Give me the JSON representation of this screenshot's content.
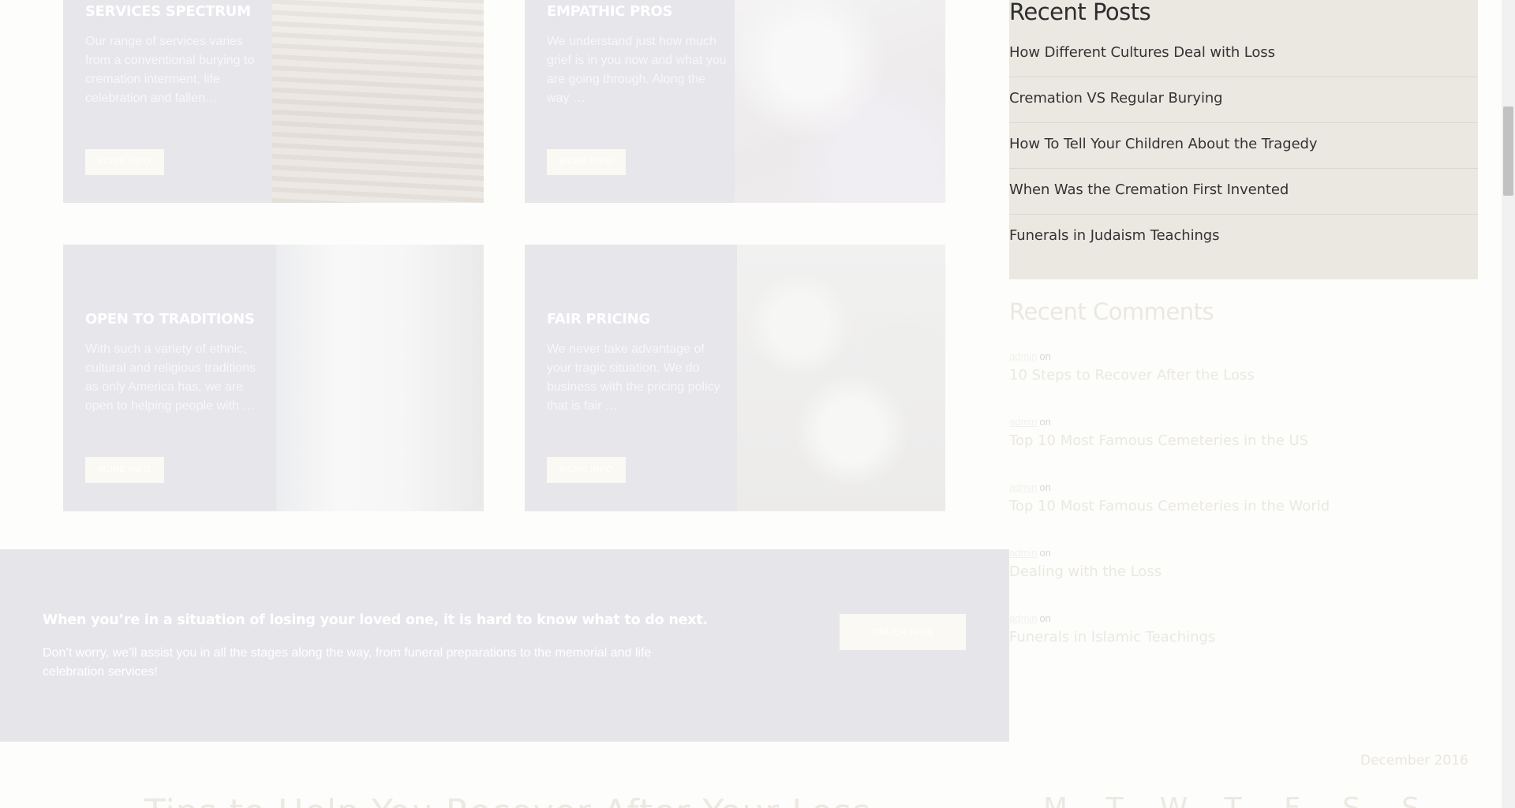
{
  "services": [
    {
      "title": "SERVICES SPECTRUM",
      "description": "Our range of services varies from a conventional burying to cremation interment, life celebration and fallen…",
      "button": "MORE INFO",
      "image_icon": "casket-photo"
    },
    {
      "title": "EMPATHIC PROS",
      "description": "We understand just how much grief is in you now and what you are going through. Along the way …",
      "button": "MORE INFO",
      "image_icon": "angel-statue-photo"
    },
    {
      "title": "OPEN TO TRADITIONS",
      "description": "With such a variety of ethnic, cultural and religious traditions as only America has, we are open to helping people with …",
      "button": "MORE INFO",
      "image_icon": "church-photo"
    },
    {
      "title": "FAIR PRICING",
      "description": "We never take advantage of your tragic situation. We do business with the pricing policy that is fair …",
      "button": "MORE INFO",
      "image_icon": "white-roses-photo"
    }
  ],
  "cta": {
    "title": "When you’re in a situation of losing your loved one, it is hard to know what to do next.",
    "text": "Don’t worry, we’ll assist you in all the stages along the way, from funeral preparations to the memorial and life celebration services!",
    "button": "ORDER NOW"
  },
  "sidebar": {
    "recent_posts": {
      "title": "Recent Posts",
      "items": [
        "How Different Cultures Deal with Loss",
        "Cremation VS Regular Burying",
        "How To Tell Your Children About the Tragedy",
        "When Was the Cremation First Invented",
        "Funerals in Judaism Teachings"
      ]
    },
    "recent_comments": {
      "title": "Recent Comments",
      "items": [
        {
          "author": "admin",
          "on": "on",
          "post": "10 Steps to Recover After the Loss"
        },
        {
          "author": "admin",
          "on": "on",
          "post": "Top 10 Most Famous Cemeteries in the US"
        },
        {
          "author": "admin",
          "on": "on",
          "post": "Top 10 Most Famous Cemeteries in the World"
        },
        {
          "author": "admin",
          "on": "on",
          "post": "Dealing with the Loss"
        },
        {
          "author": "admin",
          "on": "on",
          "post": "Funerals in Islamic Teachings"
        }
      ]
    },
    "calendar": {
      "caption": "December 2016",
      "days": [
        "M",
        "T",
        "W",
        "T",
        "F",
        "S",
        "S"
      ]
    }
  },
  "bottom_heading": "Tips to Help You Recover After Your Loss",
  "colors": {
    "card_bg": "#e6e6eb",
    "button_bg": "#fbf9f4",
    "sidebar_bg": "#ebe8e2",
    "page_bg": "#fdfdfb"
  }
}
